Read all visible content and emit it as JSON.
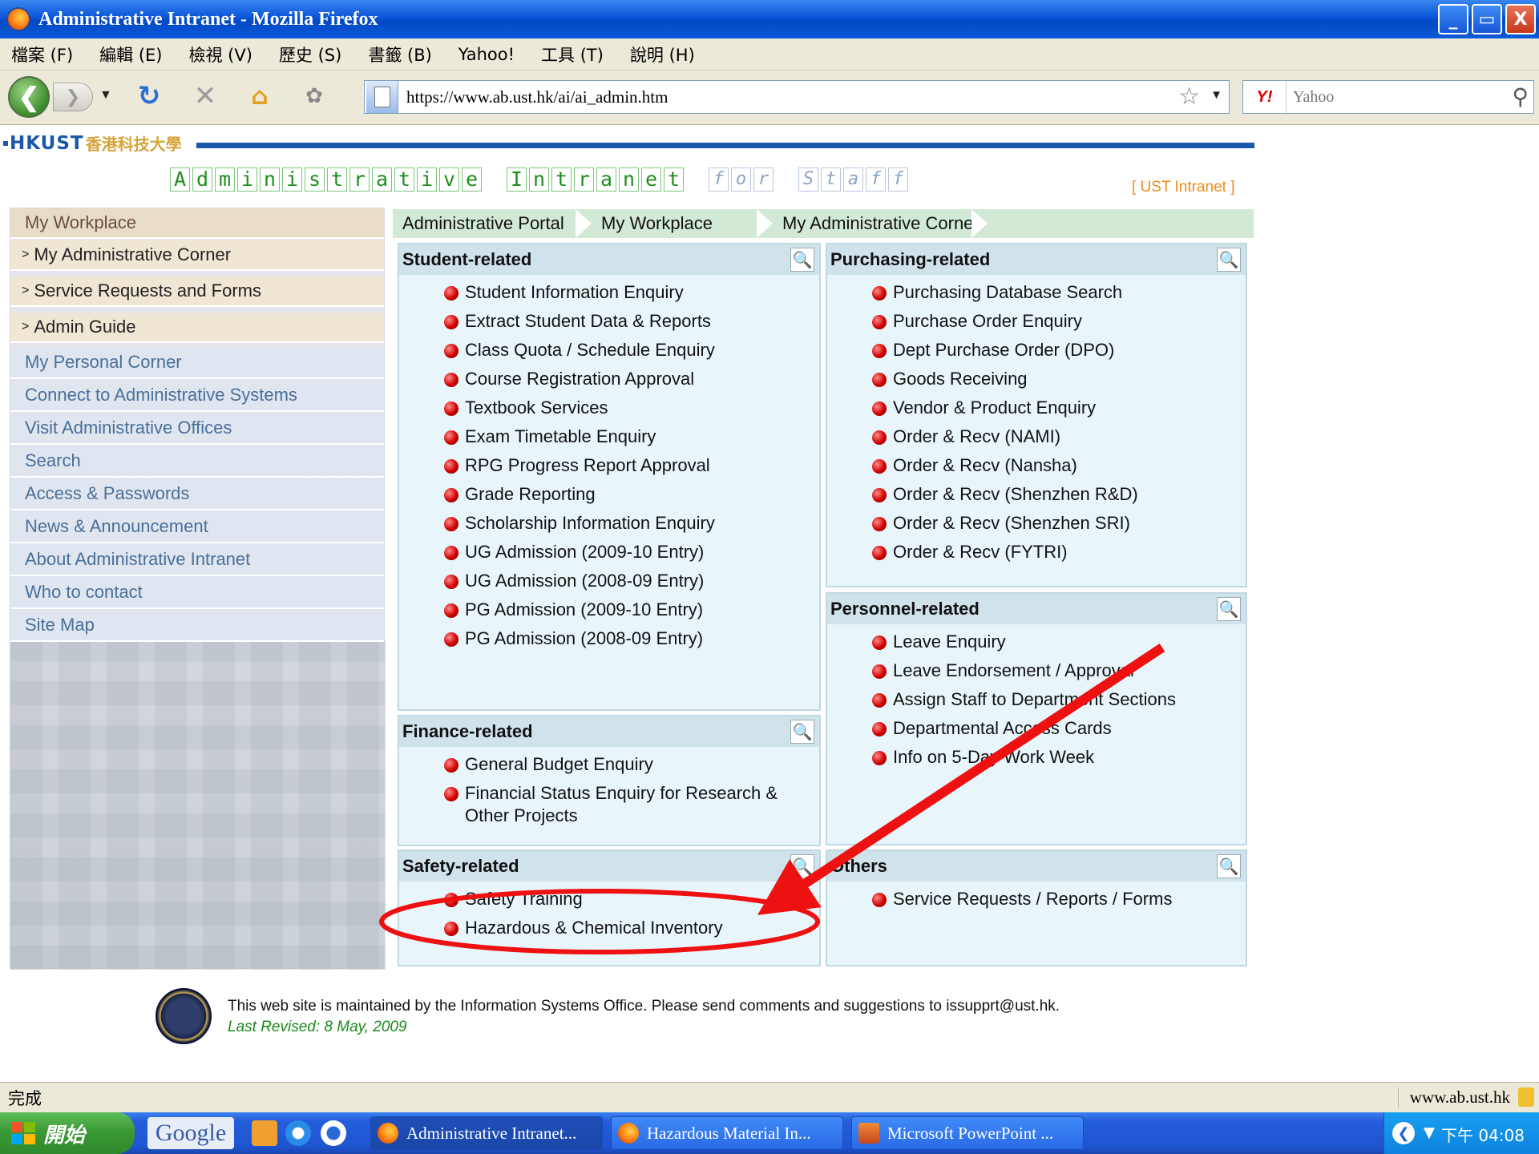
{
  "window": {
    "title": "Administrative Intranet - Mozilla Firefox",
    "buttons": {
      "minimize": "_",
      "restore": "▭",
      "close": "X"
    }
  },
  "menubar": {
    "items": [
      "檔案 (F)",
      "編輯 (E)",
      "檢視 (V)",
      "歷史 (S)",
      "書籤 (B)",
      "Yahoo!",
      "工具 (T)",
      "說明 (H)"
    ]
  },
  "toolbar": {
    "url": "https://www.ab.ust.hk/ai/ai_admin.htm",
    "search_placeholder": "Yahoo",
    "search_engine": "Y!"
  },
  "page": {
    "brand": "HKUST",
    "brand_chinese": "香港科技大學",
    "banner_letters": [
      "A",
      "d",
      "m",
      "i",
      "n",
      "i",
      "s",
      "t",
      "r",
      "a",
      "t",
      "i",
      "v",
      "e",
      " ",
      "I",
      "n",
      "t",
      "r",
      "a",
      "n",
      "e",
      "t",
      " ",
      "f",
      "o",
      "r",
      " ",
      "S",
      "t",
      "a",
      "f",
      "f"
    ],
    "banner_light_from": 24,
    "ust_intranet_link": "[ UST Intranet ]",
    "sidebar": {
      "head": "My Workplace",
      "sub_items": [
        "My Administrative Corner",
        "Service Requests and Forms",
        "Admin Guide"
      ],
      "sub_arrow": ">",
      "items": [
        "My Personal Corner",
        "Connect to Administrative Systems",
        "Visit Administrative Offices",
        "Search",
        "Access & Passwords",
        "News & Announcement",
        "About Administrative Intranet",
        "Who to contact",
        "Site Map"
      ]
    },
    "tabs": [
      "Administrative Portal",
      "My Workplace",
      "My Administrative Corner"
    ],
    "panels": {
      "student": {
        "title": "Student-related",
        "items": [
          "Student Information Enquiry",
          "Extract Student Data & Reports",
          "Class Quota / Schedule Enquiry",
          "Course Registration Approval",
          "Textbook Services",
          "Exam Timetable Enquiry",
          "RPG Progress Report Approval",
          "Grade Reporting",
          "Scholarship Information Enquiry",
          "UG Admission (2009-10 Entry)",
          "UG Admission (2008-09 Entry)",
          "PG Admission (2009-10 Entry)",
          "PG Admission (2008-09 Entry)"
        ]
      },
      "purchasing": {
        "title": "Purchasing-related",
        "items": [
          "Purchasing Database Search",
          "Purchase Order Enquiry",
          "Dept Purchase Order (DPO)",
          "Goods Receiving",
          "Vendor & Product Enquiry",
          "Order & Recv (NAMI)",
          "Order & Recv (Nansha)",
          "Order & Recv (Shenzhen R&D)",
          "Order & Recv (Shenzhen SRI)",
          "Order & Recv (FYTRI)"
        ]
      },
      "personnel": {
        "title": "Personnel-related",
        "items": [
          "Leave Enquiry",
          "Leave Endorsement / Approval",
          "Assign Staff to Department Sections",
          "Departmental Access Cards",
          "Info on 5-Day Work Week"
        ]
      },
      "finance": {
        "title": "Finance-related",
        "items": [
          "General Budget Enquiry",
          "Financial Status Enquiry for Research & Other Projects"
        ]
      },
      "safety": {
        "title": "Safety-related",
        "items": [
          "Safety Training",
          "Hazardous & Chemical Inventory"
        ]
      },
      "others": {
        "title": "Others",
        "items": [
          "Service Requests / Reports / Forms"
        ]
      }
    },
    "footer": {
      "maintained": "This web site is maintained by the Information Systems Office. Please send comments and suggestions to issupprt@ust.hk.",
      "revised": "Last Revised: 8 May, 2009"
    }
  },
  "annotation_color": "#ee1111",
  "statusbar": {
    "status": "完成",
    "domain": "www.ab.ust.hk"
  },
  "taskbar": {
    "start": "開始",
    "google": "Google",
    "tasks": [
      "Administrative Intranet...",
      "Hazardous Material In...",
      "Microsoft PowerPoint ..."
    ],
    "clock": "下午 04:08"
  }
}
